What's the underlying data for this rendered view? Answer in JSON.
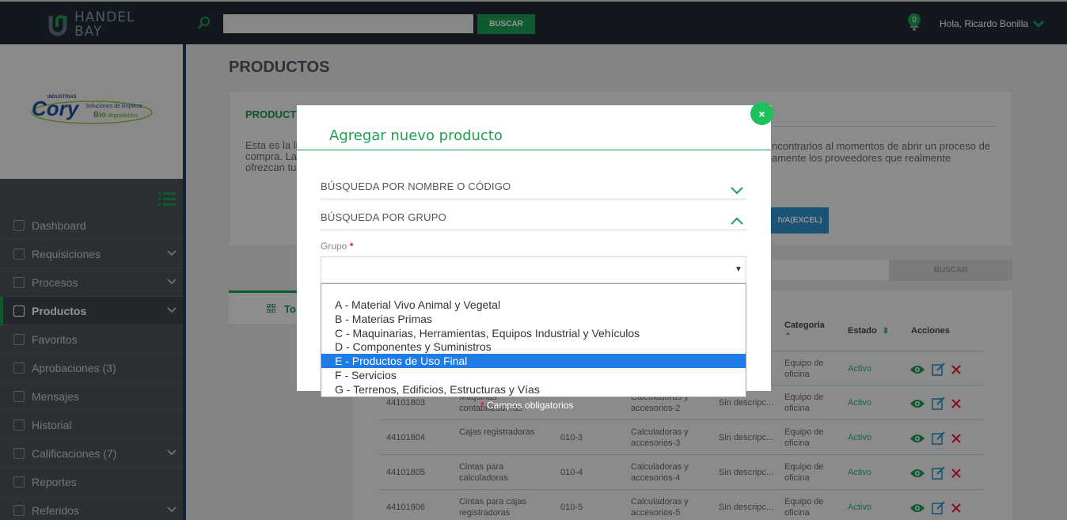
{
  "header": {
    "logo_line1": "HANDEL",
    "logo_line2": "BAY",
    "search_placeholder": "",
    "search_button": "BUSCAR",
    "notification_count": "0",
    "greeting": "Hola, Ricardo Bonilla"
  },
  "company_logo": {
    "top": "INDUSTRIAS",
    "name": "Cory",
    "tagline1": "Soluciones de limpieza",
    "tagline2_bio": "Bio",
    "tagline2_rest": "degradables"
  },
  "sidebar": {
    "items": [
      {
        "label": "Dashboard",
        "has_chevron": false,
        "active": false
      },
      {
        "label": "Requisiciones",
        "has_chevron": true,
        "active": false
      },
      {
        "label": "Procesos",
        "has_chevron": true,
        "active": false
      },
      {
        "label": "Productos",
        "has_chevron": true,
        "active": true
      },
      {
        "label": "Favoritos",
        "has_chevron": false,
        "active": false
      },
      {
        "label": "Aprobaciones (3)",
        "has_chevron": false,
        "active": false
      },
      {
        "label": "Mensajes",
        "has_chevron": false,
        "active": false
      },
      {
        "label": "Historial",
        "has_chevron": false,
        "active": false
      },
      {
        "label": "Calificaciones (7)",
        "has_chevron": true,
        "active": false
      },
      {
        "label": "Reportes",
        "has_chevron": false,
        "active": false
      },
      {
        "label": "Referidos",
        "has_chevron": true,
        "active": false
      }
    ]
  },
  "main": {
    "title": "PRODUCTOS",
    "card_title": "PRODUCT",
    "card_text_left": "Esta es la li compra. La ofrezcan tu",
    "card_text_right": "ncontrarlos al momentos de abrir un proceso de amente los proveedores que realmente",
    "excel_button": "IVA(EXCEL)",
    "search_button": "BUSCAR",
    "tab_label": "To",
    "table": {
      "headers": {
        "categoria": "Categoría",
        "estado": "Estado",
        "acciones": "Acciones"
      },
      "rows": [
        {
          "code": "",
          "name": "",
          "sku": "",
          "sub": "",
          "desc": "",
          "cat": "Equipo de oficina",
          "estado": "Activo"
        },
        {
          "code": "44101803",
          "name": "Máquinas contabilizadoras",
          "sku": "",
          "sub": "Calculadoras y accesorios-2",
          "desc": "Sin descripc...",
          "cat": "Equipo de oficina",
          "estado": "Activo"
        },
        {
          "code": "44101804",
          "name": "Cajas registradoras",
          "sku": "010-3",
          "sub": "Calculadoras y accesorios-3",
          "desc": "Sin descripc...",
          "cat": "Equipo de oficina",
          "estado": "Activo"
        },
        {
          "code": "44101805",
          "name": "Cintas para calculadoras",
          "sku": "010-4",
          "sub": "Calculadoras y accesorios-4",
          "desc": "Sin descripc...",
          "cat": "Equipo de oficina",
          "estado": "Activo"
        },
        {
          "code": "44101806",
          "name": "Cintas para cajas registradoras",
          "sku": "010-5",
          "sub": "Calculadoras y accesorios-5",
          "desc": "Sin descripc...",
          "cat": "Equipo de oficina",
          "estado": "Activo"
        }
      ]
    }
  },
  "modal": {
    "title": "Agregar nuevo producto",
    "close": "×",
    "accordion1": "BÚSQUEDA POR NOMBRE O CÓDIGO",
    "accordion2": "BÚSQUEDA POR GRUPO",
    "grupo_label": "Grupo",
    "required_mark": "*",
    "select_value": "",
    "options": [
      "A - Material Vivo Animal y Vegetal",
      "B - Materias Primas",
      "C - Maquinarias, Herramientas, Equipos Industrial y Vehículos",
      "D - Componentes y Suministros",
      "E - Productos de Uso Final",
      "F - Servicios",
      "G - Terrenos, Edificios, Estructuras y Vías"
    ],
    "selected_index": 4,
    "mandatory_note": "Campos obligatorios"
  },
  "colors": {
    "brand_green": "#1b9e52",
    "topbar": "#1f2a33",
    "sidebar": "#4d5359",
    "highlight": "#1e7ce6"
  }
}
